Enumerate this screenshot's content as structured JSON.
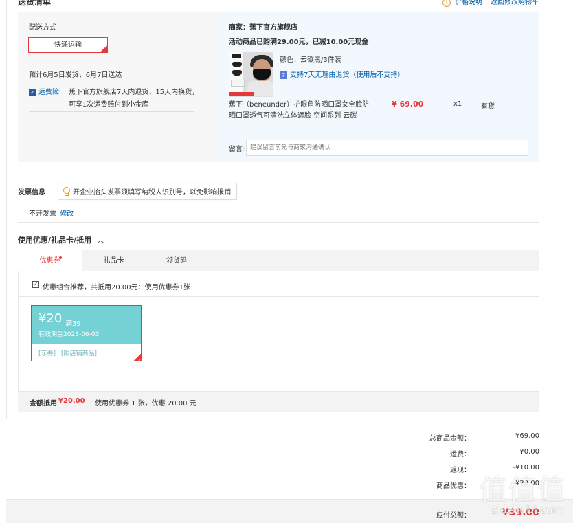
{
  "header": {
    "title": "送货清单",
    "price_info_link": "价格说明",
    "back_cart_link": "返回修改购物车"
  },
  "shipping": {
    "method_label": "配送方式",
    "method_value": "快递运输",
    "eta": "预计6月5日发货，6月7日送达",
    "insurance_label": "运费险",
    "insurance_text_1": "蕉下官方旗舰店7天内退货，15天内换货，",
    "insurance_text_2": "可享1次运费赔付到小金库"
  },
  "shop": {
    "seller_line": "商家：蕉下官方旗舰店",
    "promo_line": "活动商品已购满29.00元，已减10.00元现金",
    "color_line": "颜色：云碳黑/3件装",
    "return_policy": "支持7天无理由退货（使用后不支持）",
    "product_name_1": "蕉下（beneunder）护眼角防晒口罩女全脸防",
    "product_name_2": "晒口罩透气可清洗立体遮脸 空间系列 云碳",
    "price": "¥ 69.00",
    "qty": "x1",
    "stock": "有货",
    "note_label": "留言:",
    "note_placeholder": "建议留言前先与商家沟通确认"
  },
  "invoice": {
    "label": "发票信息",
    "tip": "开企业抬头发票须填写纳税人识别号，以免影响报销",
    "value": "不开发票",
    "edit_link": "修改"
  },
  "discount": {
    "section_title": "使用优惠/礼品卡/抵用",
    "tabs": [
      "优惠券",
      "礼品卡",
      "领货码"
    ],
    "combo_text": "优惠组合推荐，共抵用20.00元：使用优惠券1张",
    "coupon": {
      "amount": "¥20",
      "threshold": "满39",
      "validity": "有效期至2023-06-03",
      "type": "[东券]",
      "scope": "[限店铺商品]"
    },
    "summary_label": "金额抵用",
    "summary_amount": "¥20.00",
    "summary_text": "使用优惠券 1 张，优惠 20.00 元"
  },
  "totals": {
    "goods_label": "总商品金额：",
    "goods_value": "¥69.00",
    "freight_label": "运费：",
    "freight_value": "¥0.00",
    "cashback_label": "返现：",
    "cashback_value": "-¥10.00",
    "discount_label": "商品优惠：",
    "discount_value": "-¥20.00",
    "payable_label": "应付总额：",
    "payable_value": "¥39.00"
  },
  "watermark": {
    "brand": "值值值",
    "url": "zhizhubi.com"
  },
  "colors": {
    "accent_red": "#e4393c",
    "link_blue": "#005ea7",
    "coupon_teal": "#74d2d4"
  }
}
